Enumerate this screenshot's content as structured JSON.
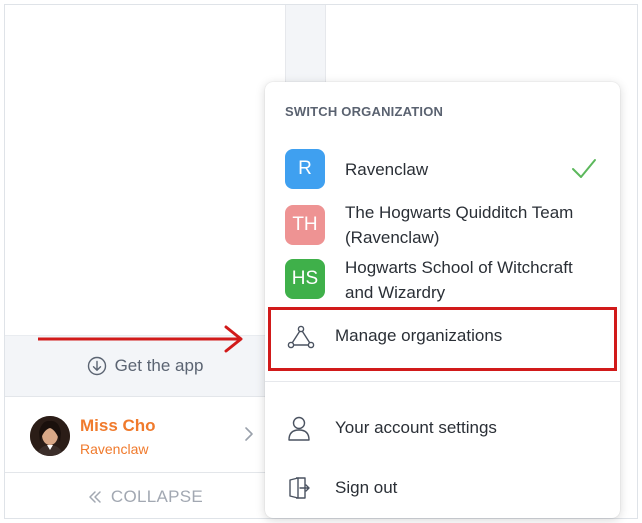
{
  "sidebar": {
    "get_app_label": "Get the app",
    "user": {
      "name": "Miss Cho",
      "organization": "Ravenclaw"
    },
    "collapse_label": "COLLAPSE"
  },
  "org_menu": {
    "header": "SWITCH ORGANIZATION",
    "organizations": [
      {
        "initials": "R",
        "name": "Ravenclaw",
        "color": "#3fa0f0",
        "selected": true
      },
      {
        "initials": "TH",
        "name": "The Hogwarts Quidditch Team (Ravenclaw)",
        "color": "#ee9393",
        "selected": false
      },
      {
        "initials": "HS",
        "name": "Hogwarts School of Witchcraft and Wizardry",
        "color": "#3fb04a",
        "selected": false
      }
    ],
    "manage_label": "Manage organizations",
    "account_settings_label": "Your account settings",
    "sign_out_label": "Sign out"
  },
  "colors": {
    "accent_orange": "#f07a2c",
    "check_green": "#5cb85c",
    "annotation_red": "#d11a1a"
  }
}
